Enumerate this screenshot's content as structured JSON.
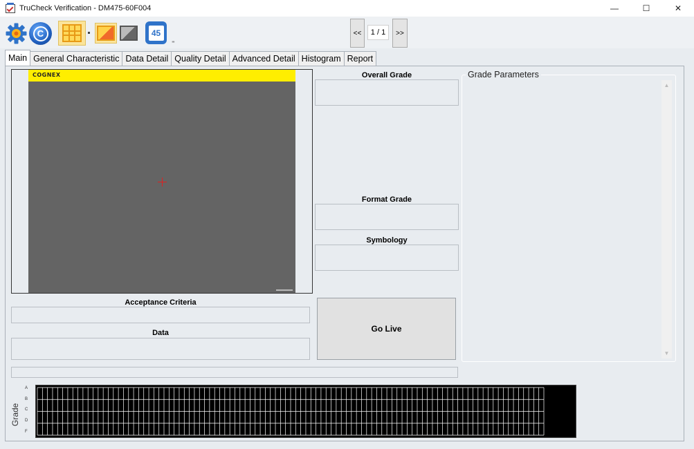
{
  "window": {
    "title": "TruCheck Verification - DM475-60F004",
    "minimize": "—",
    "maximize": "☐",
    "close": "✕"
  },
  "toolbar": {
    "icons": [
      "gear-icon",
      "cognex-c-icon",
      "grid-icon",
      "color-image-icon",
      "gray-image-icon",
      "number-45-icon"
    ],
    "cognex_letter": "C",
    "number_label": "45",
    "overflow": "₌"
  },
  "pager": {
    "prev": "<<",
    "label": "1 / 1",
    "next": ">>"
  },
  "tabs": [
    {
      "label": "Main",
      "active": true
    },
    {
      "label": "General Characteristic"
    },
    {
      "label": "Data Detail"
    },
    {
      "label": "Quality Detail"
    },
    {
      "label": "Advanced Detail"
    },
    {
      "label": "Histogram"
    },
    {
      "label": "Report"
    }
  ],
  "viewer": {
    "logo": "COGNEX",
    "banner_color": "#ffee00"
  },
  "main": {
    "overall_grade_label": "Overall Grade",
    "overall_grade_value": "",
    "format_grade_label": "Format Grade",
    "format_grade_value": "",
    "symbology_label": "Symbology",
    "symbology_value": "",
    "acceptance_criteria_label": "Acceptance Criteria",
    "acceptance_criteria_value": "",
    "data_label": "Data",
    "data_value": "",
    "go_live_label": "Go Live",
    "grade_parameters_title": "Grade Parameters"
  },
  "grade_chart": {
    "ylabel": "Grade",
    "ticks": [
      "A",
      "B",
      "C",
      "D",
      "F"
    ]
  }
}
